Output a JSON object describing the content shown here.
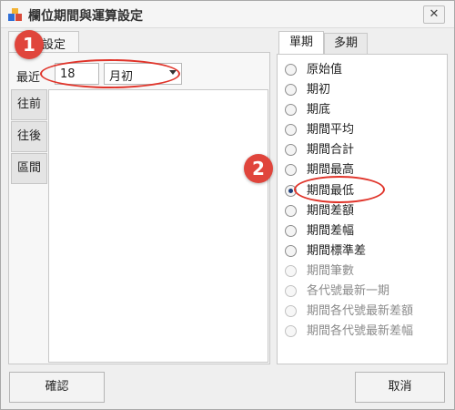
{
  "window": {
    "title": "欄位期間與運算設定",
    "close_glyph": "✕"
  },
  "left_tab": {
    "label": "設定"
  },
  "recent": {
    "label": "最近",
    "value": "18",
    "select_value": "月初"
  },
  "side_tabs": [
    "往前",
    "往後",
    "區間"
  ],
  "right_tabs": {
    "active": "單期",
    "inactive": "多期"
  },
  "options": [
    {
      "label": "原始值",
      "checked": false,
      "disabled": false
    },
    {
      "label": "期初",
      "checked": false,
      "disabled": false
    },
    {
      "label": "期底",
      "checked": false,
      "disabled": false
    },
    {
      "label": "期間平均",
      "checked": false,
      "disabled": false
    },
    {
      "label": "期間合計",
      "checked": false,
      "disabled": false
    },
    {
      "label": "期間最高",
      "checked": false,
      "disabled": false
    },
    {
      "label": "期間最低",
      "checked": true,
      "disabled": false
    },
    {
      "label": "期間差額",
      "checked": false,
      "disabled": false
    },
    {
      "label": "期間差幅",
      "checked": false,
      "disabled": false
    },
    {
      "label": "期間標準差",
      "checked": false,
      "disabled": false
    },
    {
      "label": "期間筆數",
      "checked": false,
      "disabled": true
    },
    {
      "label": "各代號最新一期",
      "checked": false,
      "disabled": true
    },
    {
      "label": "期間各代號最新差額",
      "checked": false,
      "disabled": true
    },
    {
      "label": "期間各代號最新差幅",
      "checked": false,
      "disabled": true
    }
  ],
  "buttons": {
    "ok": "確認",
    "cancel": "取消"
  },
  "annotations": {
    "badge1": "1",
    "badge2": "2"
  },
  "colors": {
    "annotation_red": "#e0342a",
    "radio_checked": "#1d3e7a"
  }
}
